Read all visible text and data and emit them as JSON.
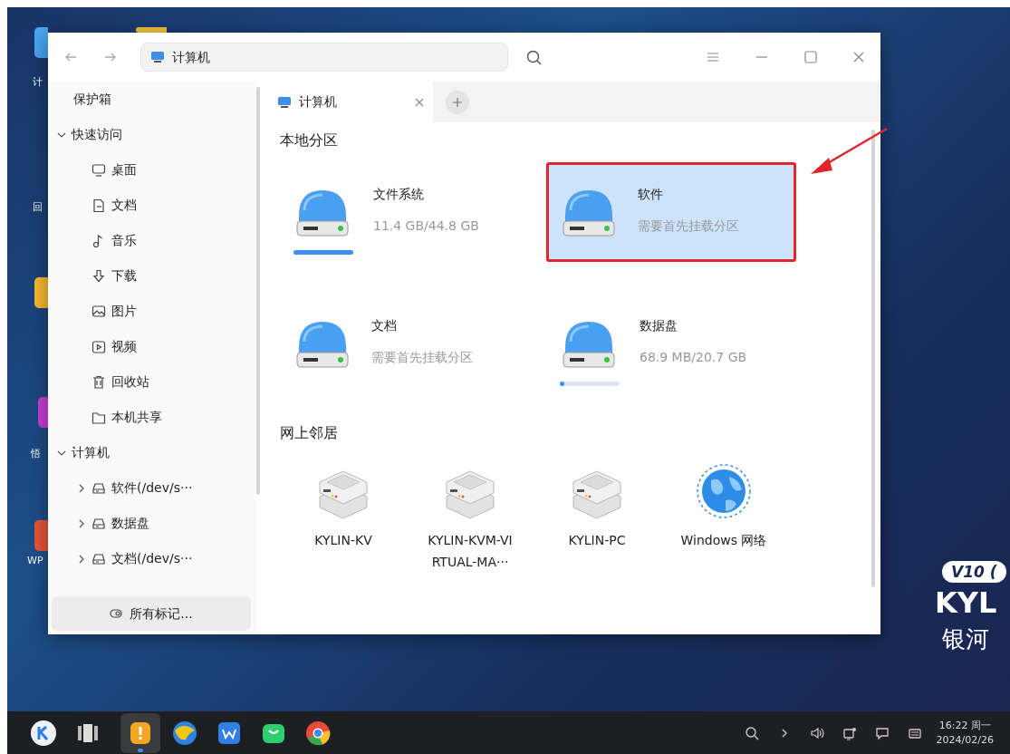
{
  "desktop": {
    "left_labels": [
      "计",
      "回",
      "悟",
      "WP"
    ],
    "brand": {
      "badge": "V10 (",
      "logo": "KYL",
      "subtitle": "银河"
    }
  },
  "window": {
    "address": "计算机",
    "sidebar": [
      {
        "label": "保护箱",
        "kind": "plain"
      },
      {
        "label": "快速访问",
        "kind": "group",
        "expanded": true,
        "children": [
          {
            "label": "桌面",
            "kind": "desktop"
          },
          {
            "label": "文档",
            "kind": "document"
          },
          {
            "label": "音乐",
            "kind": "music"
          },
          {
            "label": "下载",
            "kind": "download"
          },
          {
            "label": "图片",
            "kind": "image"
          },
          {
            "label": "视频",
            "kind": "video"
          },
          {
            "label": "回收站",
            "kind": "trash"
          },
          {
            "label": "本机共享",
            "kind": "folder"
          }
        ]
      },
      {
        "label": "计算机",
        "kind": "group",
        "expanded": true,
        "children": [
          {
            "label": "软件(/dev/s···",
            "kind": "drive",
            "expanded": false
          },
          {
            "label": "数据盘",
            "kind": "drive",
            "expanded": false
          },
          {
            "label": "文档(/dev/s···",
            "kind": "drive",
            "expanded": false
          }
        ]
      }
    ],
    "tags_button": "所有标记...",
    "tabs": [
      {
        "label": "计算机",
        "selected": true
      }
    ],
    "sections": [
      {
        "title": "本地分区",
        "items": [
          {
            "kind": "drive",
            "name": "文件系统",
            "detail": "11.4 GB/44.8 GB",
            "level": 1,
            "selected": false,
            "annotated": false
          },
          {
            "kind": "drive",
            "name": "软件",
            "detail": "需要首先挂载分区",
            "selected": true,
            "annotated": true
          },
          {
            "kind": "drive",
            "name": "文档",
            "detail": "需要首先挂载分区",
            "selected": false,
            "annotated": false
          },
          {
            "kind": "drive",
            "name": "数据盘",
            "detail": "68.9 MB/20.7 GB",
            "level": 0.07,
            "selected": false,
            "annotated": false
          }
        ]
      },
      {
        "title": "网上邻居",
        "items": [
          {
            "kind": "server",
            "name": "KYLIN-KV",
            "selected": false,
            "annotated": false
          },
          {
            "kind": "server",
            "name": "KYLIN-KVM-VIRTUAL-MA···",
            "selected": false,
            "annotated": false
          },
          {
            "kind": "server",
            "name": "KYLIN-PC",
            "selected": false,
            "annotated": false
          },
          {
            "kind": "network",
            "name": "Windows 网络",
            "selected": false,
            "annotated": false
          }
        ]
      }
    ]
  },
  "taskbar": {
    "apps": [
      {
        "kind": "launcher",
        "active": false
      },
      {
        "kind": "multitask",
        "active": false
      },
      {
        "kind": "notes",
        "active": true
      },
      {
        "kind": "browser",
        "active": false
      },
      {
        "kind": "office",
        "active": false
      },
      {
        "kind": "chat",
        "active": false
      },
      {
        "kind": "chrome",
        "active": false
      }
    ],
    "clock": {
      "time": "16:22 周一",
      "date": "2024/02/26"
    }
  }
}
